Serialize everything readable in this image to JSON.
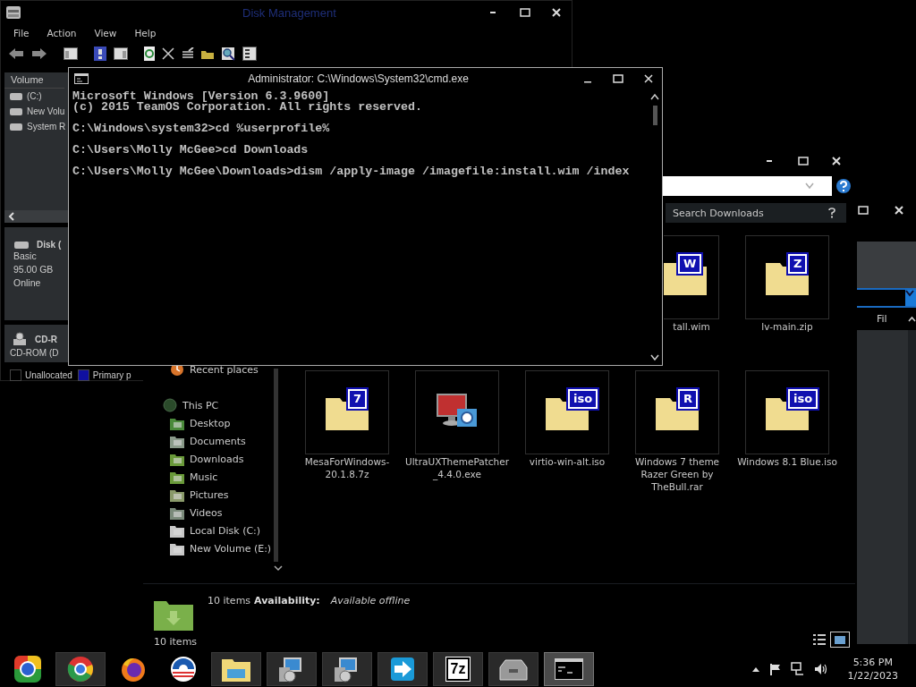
{
  "disk_management": {
    "title": "Disk Management",
    "menu": [
      "File",
      "Action",
      "View",
      "Help"
    ],
    "volumes": {
      "header": "Volume",
      "rows": [
        "(C:)",
        "New Volu",
        "System R"
      ]
    },
    "disks": [
      {
        "kind": "disk",
        "name": "Disk (",
        "lines": [
          "Basic",
          "95.00 GB",
          "Online"
        ]
      },
      {
        "kind": "cdrom",
        "name": "CD-R",
        "lines": [
          "CD-ROM (D"
        ]
      }
    ],
    "legend": [
      {
        "label": "Unallocated",
        "color": "#000000"
      },
      {
        "label": "Primary p",
        "color": "#1010a0"
      }
    ]
  },
  "cmd": {
    "title": "Administrator: C:\\Windows\\System32\\cmd.exe",
    "blocks": [
      [
        "Microsoft Windows [Version 6.3.9600]",
        "(c) 2015 TeamOS Corporation. All rights reserved."
      ],
      [
        "C:\\Windows\\system32>cd %userprofile%"
      ],
      [
        "C:\\Users\\Molly McGee>cd Downloads"
      ],
      [
        "C:\\Users\\Molly McGee\\Downloads>dism /apply-image /imagefile:install.wim /index"
      ]
    ]
  },
  "explorer": {
    "search": {
      "placeholder": "Search Downloads"
    },
    "nav": [
      {
        "label": "Recent places",
        "kind": "recent"
      },
      {
        "label": "This PC",
        "kind": "pc",
        "children": [
          {
            "label": "Desktop",
            "kind": "desktop"
          },
          {
            "label": "Documents",
            "kind": "documents"
          },
          {
            "label": "Downloads",
            "kind": "downloads"
          },
          {
            "label": "Music",
            "kind": "music"
          },
          {
            "label": "Pictures",
            "kind": "pictures"
          },
          {
            "label": "Videos",
            "kind": "videos"
          },
          {
            "label": "Local Disk (C:)",
            "kind": "drive"
          },
          {
            "label": "New Volume (E:)",
            "kind": "drive"
          }
        ]
      }
    ],
    "files_top": [
      {
        "name": "tall.wim",
        "kind": "archive",
        "badge": "W"
      },
      {
        "name": "lv-main.zip",
        "kind": "archive",
        "badge": "Z"
      }
    ],
    "files": [
      {
        "name": "MesaForWindows-20.1.8.7z",
        "kind": "archive",
        "badge": "7"
      },
      {
        "name": "UltraUXThemePatcher_4.4.0.exe",
        "kind": "program"
      },
      {
        "name": "virtio-win-alt.iso",
        "kind": "archive",
        "badge": "iso"
      },
      {
        "name": "Windows 7 theme Razer Green by TheBull.rar",
        "kind": "archive",
        "badge": "R"
      },
      {
        "name": "Windows 8.1 Blue.iso",
        "kind": "archive",
        "badge": "iso"
      }
    ],
    "status": {
      "count": "10 items",
      "availability_label": "Availability:",
      "availability": "Available offline"
    },
    "details": {
      "count": "10 items"
    }
  },
  "side_window": {
    "column_label": "Fil"
  },
  "taskbar": {
    "apps": [
      {
        "kind": "start",
        "open": false,
        "selected": false
      },
      {
        "kind": "chrome",
        "open": true,
        "selected": false
      },
      {
        "kind": "firefox",
        "open": false,
        "selected": false
      },
      {
        "kind": "campaign",
        "open": false,
        "selected": false
      },
      {
        "kind": "folder",
        "open": true,
        "selected": false
      },
      {
        "kind": "installer",
        "open": true,
        "selected": false
      },
      {
        "kind": "installer",
        "open": true,
        "selected": false
      },
      {
        "kind": "send",
        "open": true,
        "selected": false
      },
      {
        "kind": "archiver",
        "open": true,
        "selected": false,
        "label": "7z"
      },
      {
        "kind": "toolbox",
        "open": true,
        "selected": false
      },
      {
        "kind": "console",
        "open": true,
        "selected": true
      }
    ],
    "clock": {
      "time": "5:36 PM",
      "date": "1/22/2023"
    }
  }
}
